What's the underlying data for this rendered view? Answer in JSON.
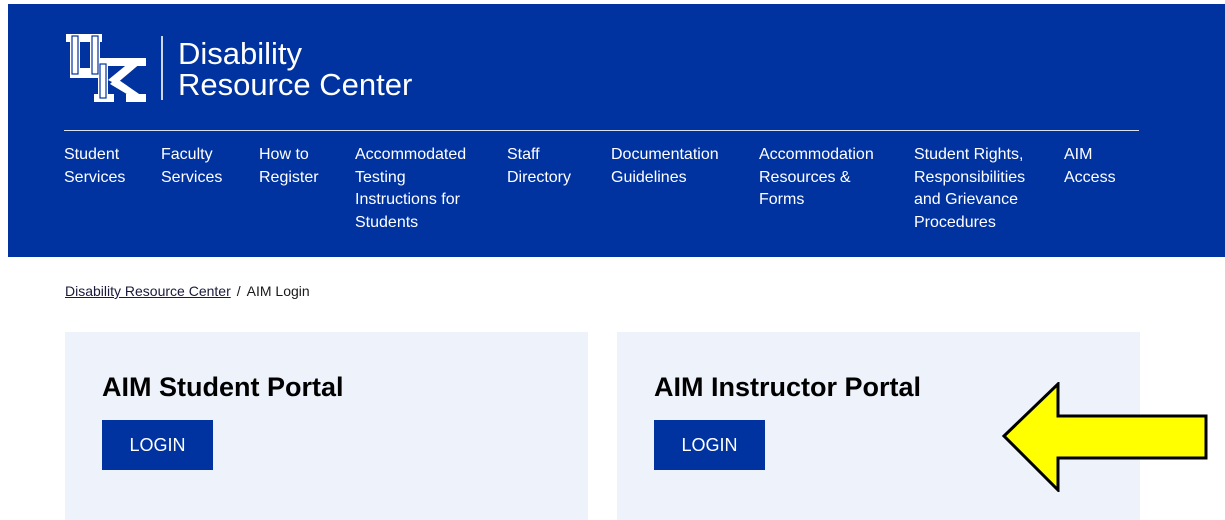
{
  "colors": {
    "brand": "#0033a0",
    "card": "#eef2fa",
    "arrow": "#ffff00"
  },
  "header": {
    "logo_icon": "uk-logo-icon",
    "title_line1": "Disability",
    "title_line2": "Resource Center"
  },
  "nav": {
    "items": [
      {
        "label": "Student\nServices"
      },
      {
        "label": "Faculty\nServices"
      },
      {
        "label": "How to\nRegister"
      },
      {
        "label": "Accommodated\nTesting\nInstructions for\nStudents"
      },
      {
        "label": "Staff\nDirectory"
      },
      {
        "label": "Documentation\nGuidelines"
      },
      {
        "label": "Accommodation\nResources &\nForms"
      },
      {
        "label": "Student Rights,\nResponsibilities\nand Grievance\nProcedures"
      },
      {
        "label": "AIM\nAccess"
      }
    ]
  },
  "breadcrumb": {
    "parent": "Disability Resource Center",
    "separator": "/",
    "current": "AIM Login"
  },
  "student_portal": {
    "title": "AIM Student Portal",
    "button": "LOGIN"
  },
  "instructor_portal": {
    "title": "AIM Instructor Portal",
    "button": "LOGIN"
  },
  "annotation": {
    "icon": "left-arrow-icon"
  }
}
